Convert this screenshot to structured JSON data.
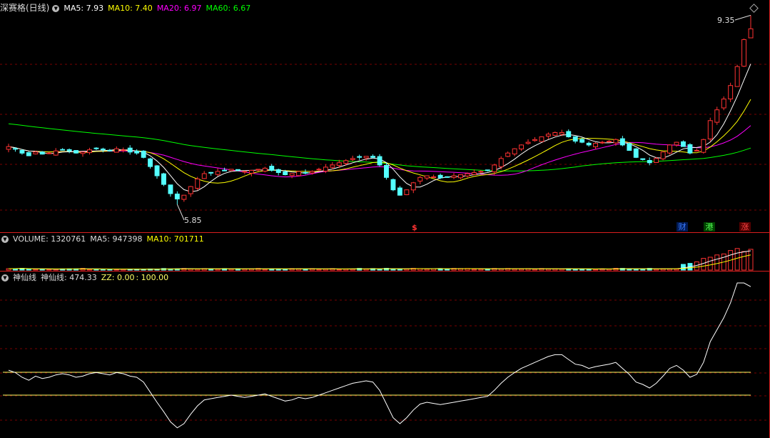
{
  "title": "深赛格(日线)",
  "colors": {
    "up": "#ff3232",
    "down": "#54ffff",
    "ma5": "#ffffff",
    "ma10": "#ffff00",
    "ma20": "#ff00ff",
    "ma60": "#00ff00",
    "grid": "#7a0000",
    "divider": "#d81e1e",
    "line": "#ffffff",
    "hline": "#ffff66"
  },
  "legend": {
    "ma5": "MA5: 7.93",
    "ma10": "MA10: 7.40",
    "ma20": "MA20: 6.97",
    "ma60": "MA60: 6.67"
  },
  "volume_legend": {
    "label": "VOLUME: 1320761",
    "ma5": "MA5: 947398",
    "ma10": "MA10: 701711"
  },
  "indicator_legend": {
    "name": "神仙线",
    "value": "神仙线: 474.33",
    "zz": "ZZ: 0.00",
    "zz2": ": 100.00"
  },
  "annotations": {
    "high_label": "9.35",
    "low_label": "5.85",
    "markers": [
      {
        "text": "财",
        "color": "#3a7bff",
        "bg": "#001a55"
      },
      {
        "text": "港",
        "color": "#55ff55",
        "bg": "#004400"
      },
      {
        "text": "涨",
        "color": "#ff4444",
        "bg": "#550000"
      }
    ],
    "mid_marker": "$"
  },
  "icons": [
    "collapse-arrow-icon",
    "settings-diamond-icon"
  ],
  "chart_data": [
    {
      "type": "candlestick",
      "title": "深赛格(日线)",
      "price_range": [
        5.6,
        9.5
      ],
      "high": 9.35,
      "low": 5.85,
      "seed": [
        6.92,
        6.88,
        6.8,
        6.75,
        6.82,
        6.78,
        6.8,
        6.84,
        6.86,
        6.84,
        6.8,
        6.82,
        6.86,
        6.88,
        6.86,
        6.84,
        6.88,
        6.86,
        6.82,
        6.8,
        6.72,
        6.55,
        6.38,
        6.22,
        6.05,
        5.95,
        6.02,
        6.18,
        6.32,
        6.42,
        6.44,
        6.46,
        6.48,
        6.5,
        6.48,
        6.46,
        6.48,
        6.5,
        6.52,
        6.48,
        6.44,
        6.4,
        6.42,
        6.46,
        6.44,
        6.46,
        6.5,
        6.54,
        6.58,
        6.62,
        6.66,
        6.7,
        6.72,
        6.74,
        6.72,
        6.58,
        6.35,
        6.12,
        6.02,
        6.12,
        6.25,
        6.35,
        6.38,
        6.36,
        6.34,
        6.36,
        6.38,
        6.4,
        6.42,
        6.44,
        6.46,
        6.48,
        6.58,
        6.7,
        6.8,
        6.88,
        6.95,
        7.0,
        7.05,
        7.1,
        7.15,
        7.18,
        7.18,
        7.1,
        7.02,
        7.0,
        6.95,
        6.98,
        7.0,
        7.02,
        7.05,
        6.95,
        6.85,
        6.72,
        6.68,
        6.62,
        6.7,
        6.82,
        6.95,
        7.0,
        6.92,
        6.8,
        6.85,
        7.05,
        7.4,
        7.6,
        7.8,
        8.05,
        8.4,
        8.9,
        9.1
      ],
      "volume_ma": [
        947398,
        701711
      ],
      "indicator": {
        "name": "神仙线",
        "last": 474.33,
        "levels": [
          0,
          100
        ]
      }
    }
  ]
}
